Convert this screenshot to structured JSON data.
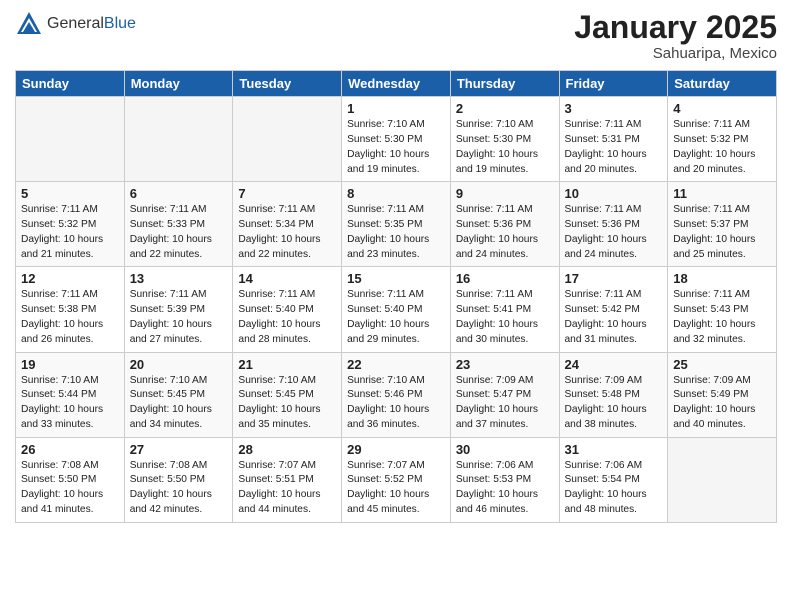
{
  "header": {
    "logo_general": "General",
    "logo_blue": "Blue",
    "month": "January 2025",
    "location": "Sahuaripa, Mexico"
  },
  "weekdays": [
    "Sunday",
    "Monday",
    "Tuesday",
    "Wednesday",
    "Thursday",
    "Friday",
    "Saturday"
  ],
  "weeks": [
    [
      {
        "day": "",
        "info": ""
      },
      {
        "day": "",
        "info": ""
      },
      {
        "day": "",
        "info": ""
      },
      {
        "day": "1",
        "info": "Sunrise: 7:10 AM\nSunset: 5:30 PM\nDaylight: 10 hours\nand 19 minutes."
      },
      {
        "day": "2",
        "info": "Sunrise: 7:10 AM\nSunset: 5:30 PM\nDaylight: 10 hours\nand 19 minutes."
      },
      {
        "day": "3",
        "info": "Sunrise: 7:11 AM\nSunset: 5:31 PM\nDaylight: 10 hours\nand 20 minutes."
      },
      {
        "day": "4",
        "info": "Sunrise: 7:11 AM\nSunset: 5:32 PM\nDaylight: 10 hours\nand 20 minutes."
      }
    ],
    [
      {
        "day": "5",
        "info": "Sunrise: 7:11 AM\nSunset: 5:32 PM\nDaylight: 10 hours\nand 21 minutes."
      },
      {
        "day": "6",
        "info": "Sunrise: 7:11 AM\nSunset: 5:33 PM\nDaylight: 10 hours\nand 22 minutes."
      },
      {
        "day": "7",
        "info": "Sunrise: 7:11 AM\nSunset: 5:34 PM\nDaylight: 10 hours\nand 22 minutes."
      },
      {
        "day": "8",
        "info": "Sunrise: 7:11 AM\nSunset: 5:35 PM\nDaylight: 10 hours\nand 23 minutes."
      },
      {
        "day": "9",
        "info": "Sunrise: 7:11 AM\nSunset: 5:36 PM\nDaylight: 10 hours\nand 24 minutes."
      },
      {
        "day": "10",
        "info": "Sunrise: 7:11 AM\nSunset: 5:36 PM\nDaylight: 10 hours\nand 24 minutes."
      },
      {
        "day": "11",
        "info": "Sunrise: 7:11 AM\nSunset: 5:37 PM\nDaylight: 10 hours\nand 25 minutes."
      }
    ],
    [
      {
        "day": "12",
        "info": "Sunrise: 7:11 AM\nSunset: 5:38 PM\nDaylight: 10 hours\nand 26 minutes."
      },
      {
        "day": "13",
        "info": "Sunrise: 7:11 AM\nSunset: 5:39 PM\nDaylight: 10 hours\nand 27 minutes."
      },
      {
        "day": "14",
        "info": "Sunrise: 7:11 AM\nSunset: 5:40 PM\nDaylight: 10 hours\nand 28 minutes."
      },
      {
        "day": "15",
        "info": "Sunrise: 7:11 AM\nSunset: 5:40 PM\nDaylight: 10 hours\nand 29 minutes."
      },
      {
        "day": "16",
        "info": "Sunrise: 7:11 AM\nSunset: 5:41 PM\nDaylight: 10 hours\nand 30 minutes."
      },
      {
        "day": "17",
        "info": "Sunrise: 7:11 AM\nSunset: 5:42 PM\nDaylight: 10 hours\nand 31 minutes."
      },
      {
        "day": "18",
        "info": "Sunrise: 7:11 AM\nSunset: 5:43 PM\nDaylight: 10 hours\nand 32 minutes."
      }
    ],
    [
      {
        "day": "19",
        "info": "Sunrise: 7:10 AM\nSunset: 5:44 PM\nDaylight: 10 hours\nand 33 minutes."
      },
      {
        "day": "20",
        "info": "Sunrise: 7:10 AM\nSunset: 5:45 PM\nDaylight: 10 hours\nand 34 minutes."
      },
      {
        "day": "21",
        "info": "Sunrise: 7:10 AM\nSunset: 5:45 PM\nDaylight: 10 hours\nand 35 minutes."
      },
      {
        "day": "22",
        "info": "Sunrise: 7:10 AM\nSunset: 5:46 PM\nDaylight: 10 hours\nand 36 minutes."
      },
      {
        "day": "23",
        "info": "Sunrise: 7:09 AM\nSunset: 5:47 PM\nDaylight: 10 hours\nand 37 minutes."
      },
      {
        "day": "24",
        "info": "Sunrise: 7:09 AM\nSunset: 5:48 PM\nDaylight: 10 hours\nand 38 minutes."
      },
      {
        "day": "25",
        "info": "Sunrise: 7:09 AM\nSunset: 5:49 PM\nDaylight: 10 hours\nand 40 minutes."
      }
    ],
    [
      {
        "day": "26",
        "info": "Sunrise: 7:08 AM\nSunset: 5:50 PM\nDaylight: 10 hours\nand 41 minutes."
      },
      {
        "day": "27",
        "info": "Sunrise: 7:08 AM\nSunset: 5:50 PM\nDaylight: 10 hours\nand 42 minutes."
      },
      {
        "day": "28",
        "info": "Sunrise: 7:07 AM\nSunset: 5:51 PM\nDaylight: 10 hours\nand 44 minutes."
      },
      {
        "day": "29",
        "info": "Sunrise: 7:07 AM\nSunset: 5:52 PM\nDaylight: 10 hours\nand 45 minutes."
      },
      {
        "day": "30",
        "info": "Sunrise: 7:06 AM\nSunset: 5:53 PM\nDaylight: 10 hours\nand 46 minutes."
      },
      {
        "day": "31",
        "info": "Sunrise: 7:06 AM\nSunset: 5:54 PM\nDaylight: 10 hours\nand 48 minutes."
      },
      {
        "day": "",
        "info": ""
      }
    ]
  ]
}
